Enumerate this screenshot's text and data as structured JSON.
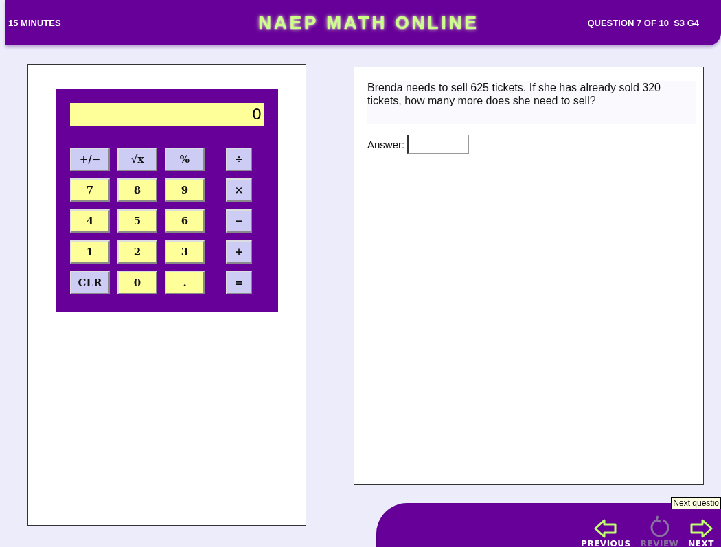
{
  "header": {
    "timer": "15 MINUTES",
    "title": "NAEP MATH ONLINE",
    "progress": "QUESTION 7 OF 10  S3 G4"
  },
  "calculator": {
    "display": "0",
    "keys": [
      {
        "label": "+/−",
        "kind": "function"
      },
      {
        "label": "√x",
        "kind": "function"
      },
      {
        "label": "%",
        "kind": "function"
      },
      {
        "label": "÷",
        "kind": "function"
      },
      {
        "label": "7",
        "kind": "digit"
      },
      {
        "label": "8",
        "kind": "digit"
      },
      {
        "label": "9",
        "kind": "digit"
      },
      {
        "label": "×",
        "kind": "function"
      },
      {
        "label": "4",
        "kind": "digit"
      },
      {
        "label": "5",
        "kind": "digit"
      },
      {
        "label": "6",
        "kind": "digit"
      },
      {
        "label": "−",
        "kind": "function"
      },
      {
        "label": "1",
        "kind": "digit"
      },
      {
        "label": "2",
        "kind": "digit"
      },
      {
        "label": "3",
        "kind": "digit"
      },
      {
        "label": "+",
        "kind": "function"
      },
      {
        "label": "CLR",
        "kind": "function"
      },
      {
        "label": "0",
        "kind": "digit"
      },
      {
        "label": ".",
        "kind": "digit"
      },
      {
        "label": "=",
        "kind": "function"
      }
    ]
  },
  "question": {
    "text": "Brenda needs to sell 625 tickets. If she has already sold 320 tickets, how many more does she need to sell?",
    "answer_label": "Answer:"
  },
  "nav": [
    {
      "label": "PREVIOUS",
      "kind": "previous",
      "disabled": false
    },
    {
      "label": "REVIEW",
      "kind": "review",
      "disabled": true
    },
    {
      "label": "NEXT",
      "kind": "next",
      "disabled": false
    }
  ],
  "tooltip": "Next questio"
}
